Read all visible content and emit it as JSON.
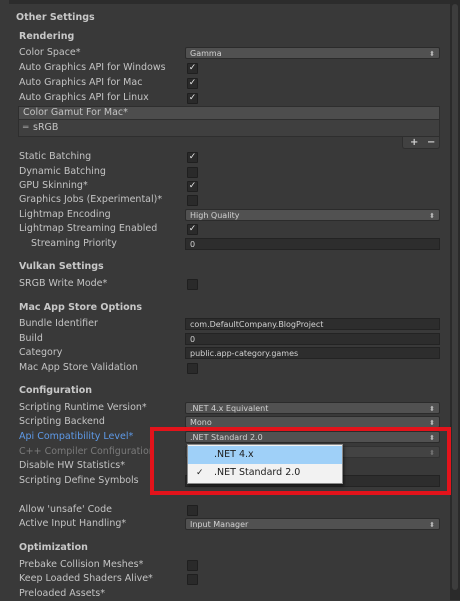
{
  "sections": {
    "other_settings": "Other Settings",
    "rendering": "Rendering",
    "vulkan": "Vulkan Settings",
    "mac_store": "Mac App Store Options",
    "configuration": "Configuration",
    "optimization": "Optimization"
  },
  "rendering": {
    "color_space": {
      "label": "Color Space*",
      "value": "Gamma"
    },
    "auto_graphics_windows": {
      "label": "Auto Graphics API  for Windows",
      "checked": true
    },
    "auto_graphics_mac": {
      "label": "Auto Graphics API  for Mac",
      "checked": true
    },
    "auto_graphics_linux": {
      "label": "Auto Graphics API  for Linux",
      "checked": true
    },
    "color_gamut": {
      "header": "Color Gamut For Mac*",
      "items": [
        "sRGB"
      ]
    },
    "static_batching": {
      "label": "Static Batching",
      "checked": true
    },
    "dynamic_batching": {
      "label": "Dynamic Batching",
      "checked": false
    },
    "gpu_skinning": {
      "label": "GPU Skinning*",
      "checked": true
    },
    "graphics_jobs": {
      "label": "Graphics Jobs (Experimental)*",
      "checked": false
    },
    "lightmap_encoding": {
      "label": "Lightmap Encoding",
      "value": "High Quality"
    },
    "lightmap_streaming": {
      "label": "Lightmap Streaming Enabled",
      "checked": true
    },
    "streaming_priority": {
      "label": "Streaming Priority",
      "value": "0"
    }
  },
  "vulkan": {
    "srgb_write": {
      "label": "SRGB Write Mode*",
      "checked": false
    }
  },
  "mac_store": {
    "bundle_identifier": {
      "label": "Bundle Identifier",
      "value": "com.DefaultCompany.BlogProject"
    },
    "build": {
      "label": "Build",
      "value": "0"
    },
    "category": {
      "label": "Category",
      "value": "public.app-category.games"
    },
    "validation": {
      "label": "Mac App Store Validation",
      "checked": false
    }
  },
  "configuration": {
    "runtime_version": {
      "label": "Scripting Runtime Version*",
      "value": ".NET 4.x Equivalent"
    },
    "backend": {
      "label": "Scripting Backend",
      "value": "Mono"
    },
    "api_compat": {
      "label": "Api Compatibility Level*",
      "value": ".NET Standard 2.0"
    },
    "cpp_config": {
      "label": "C++ Compiler Configuration"
    },
    "disable_hw_stats": {
      "label": "Disable HW Statistics*"
    },
    "define_symbols": {
      "label": "Scripting Define Symbols"
    },
    "allow_unsafe": {
      "label": "Allow 'unsafe' Code",
      "checked": false
    },
    "input_handling": {
      "label": "Active Input Handling*",
      "value": "Input Manager"
    }
  },
  "optimization": {
    "prebake_collision": {
      "label": "Prebake Collision Meshes*",
      "checked": false
    },
    "keep_shaders": {
      "label": "Keep Loaded Shaders Alive*",
      "checked": false
    },
    "preloaded_assets": {
      "label": "Preloaded Assets*"
    }
  },
  "dropdown": {
    "options": [
      {
        "label": ".NET 4.x",
        "selected": false,
        "hovered": true
      },
      {
        "label": ".NET Standard 2.0",
        "selected": true,
        "hovered": false
      }
    ],
    "check_mark": "✓"
  },
  "list_buttons": {
    "add": "+",
    "remove": "−"
  },
  "highlight_color": "#e3131b"
}
